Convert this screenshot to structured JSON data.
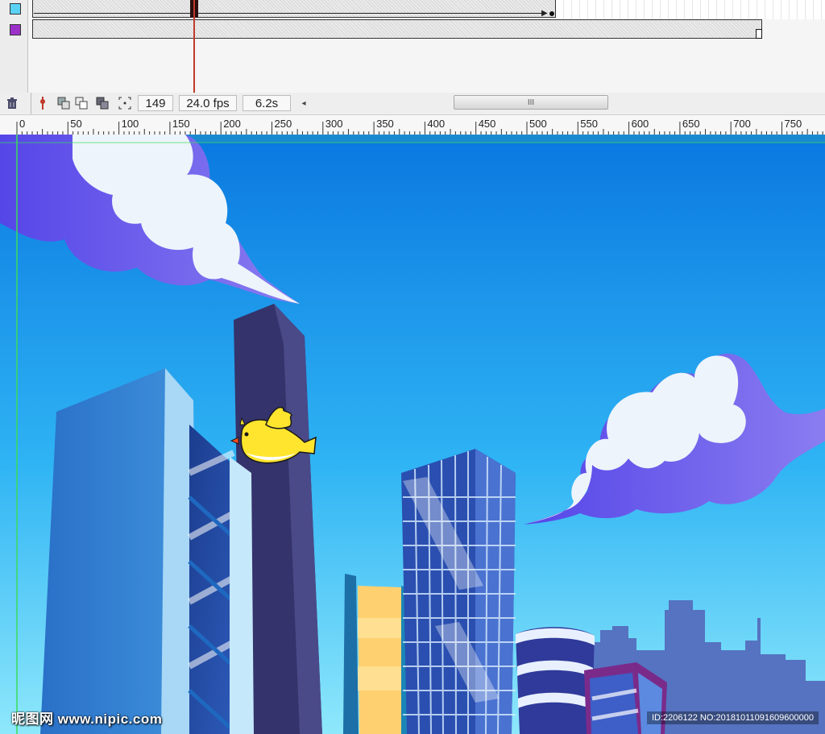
{
  "timeline": {
    "layers": [
      {
        "color": "#5ad2f4",
        "name_icon": "layer-swatch-cyan"
      },
      {
        "color": "#9b30c8",
        "name_icon": "layer-swatch-purple"
      }
    ]
  },
  "toolbar": {
    "icons": [
      "trash-icon",
      "onion-skin-marker-icon",
      "onion-skin-icon",
      "onion-outline-icon",
      "edit-multiple-frames-icon",
      "modify-markers-icon"
    ],
    "current_frame": "149",
    "frame_rate": "24.0 fps",
    "elapsed_time": "6.2s",
    "scroll_grip": "III"
  },
  "ruler": {
    "labels": [
      "0",
      "50",
      "100",
      "150",
      "200",
      "250",
      "300",
      "350",
      "400",
      "450",
      "500",
      "550",
      "600",
      "650",
      "700",
      "750"
    ]
  },
  "stage": {
    "sky_top": "#0a78e0",
    "sky_bottom": "#8ee8fb",
    "character": "yellow-bird"
  },
  "watermark": {
    "left_text": "昵图网 www.nipic.com",
    "right_text": "ID:2206122 NO:20181011091609600000"
  }
}
